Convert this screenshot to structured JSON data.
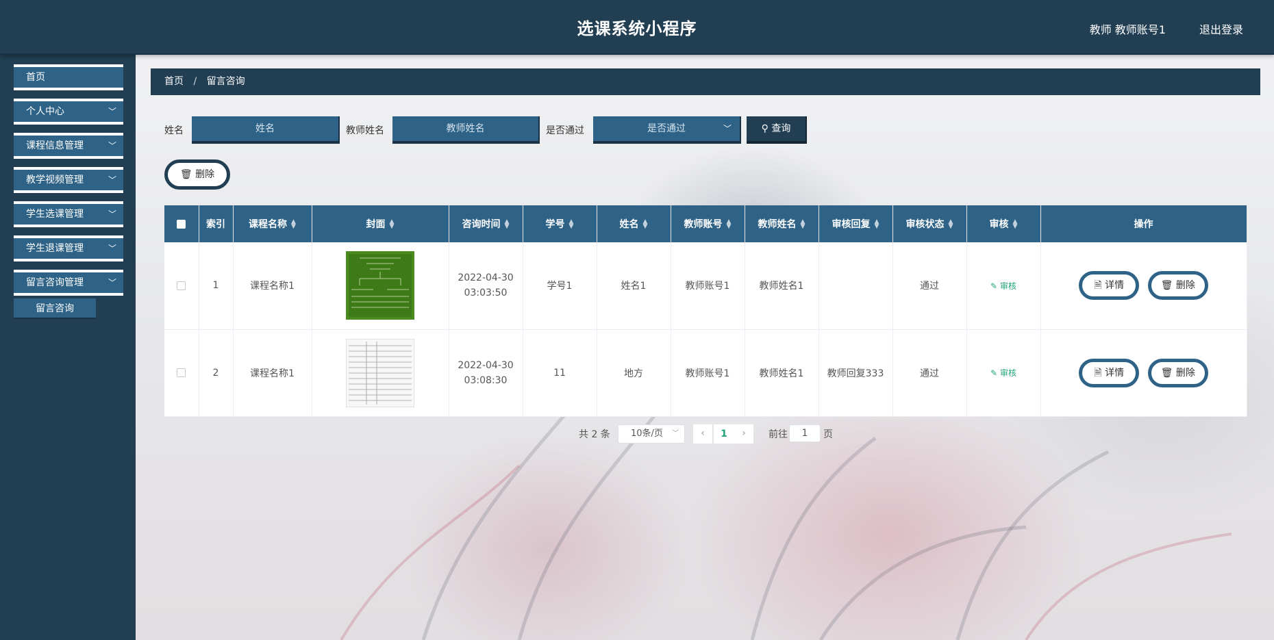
{
  "header": {
    "title": "选课系统小程序",
    "user": "教师 教师账号1",
    "logout": "退出登录"
  },
  "sidebar": {
    "items": [
      {
        "label": "首页"
      },
      {
        "label": "个人中心"
      },
      {
        "label": "课程信息管理"
      },
      {
        "label": "教学视频管理"
      },
      {
        "label": "学生选课管理"
      },
      {
        "label": "学生退课管理"
      },
      {
        "label": "留言咨询管理"
      }
    ],
    "submenu": {
      "label": "留言咨询"
    }
  },
  "breadcrumb": {
    "home": "首页",
    "separator": "/",
    "current": "留言咨询"
  },
  "search": {
    "name_label": "姓名",
    "name_placeholder": "姓名",
    "teacher_label": "教师姓名",
    "teacher_placeholder": "教师姓名",
    "pass_label": "是否通过",
    "pass_placeholder": "是否通过",
    "button": "查询"
  },
  "toolbar": {
    "delete_label": "删除"
  },
  "table": {
    "columns": [
      "索引",
      "课程名称",
      "封面",
      "咨询时间",
      "学号",
      "姓名",
      "教师账号",
      "教师姓名",
      "审核回复",
      "审核状态",
      "审核",
      "操作"
    ],
    "rows": [
      {
        "index": "1",
        "course": "课程名称1",
        "cover": "green-chart-image",
        "date": "2022-04-30",
        "time": "03:03:50",
        "student_id": "学号1",
        "name": "姓名1",
        "teacher_account": "教师账号1",
        "teacher_name": "教师姓名1",
        "reply": "",
        "status": "通过",
        "audit": "审核",
        "detail": "详情",
        "delete": "删除"
      },
      {
        "index": "2",
        "course": "课程名称1",
        "cover": "document-table-image",
        "date": "2022-04-30",
        "time": "03:08:30",
        "student_id": "11",
        "name": "地方",
        "teacher_account": "教师账号1",
        "teacher_name": "教师姓名1",
        "reply": "教师回复333",
        "status": "通过",
        "audit": "审核",
        "detail": "详情",
        "delete": "删除"
      }
    ]
  },
  "pagination": {
    "total": "共 2 条",
    "page_size": "10条/页",
    "current": "1",
    "goto_label": "前往",
    "goto_value": "1",
    "goto_unit": "页"
  },
  "colors": {
    "header": "#223e52",
    "accent": "#2e6387",
    "audit": "#22a37a"
  }
}
